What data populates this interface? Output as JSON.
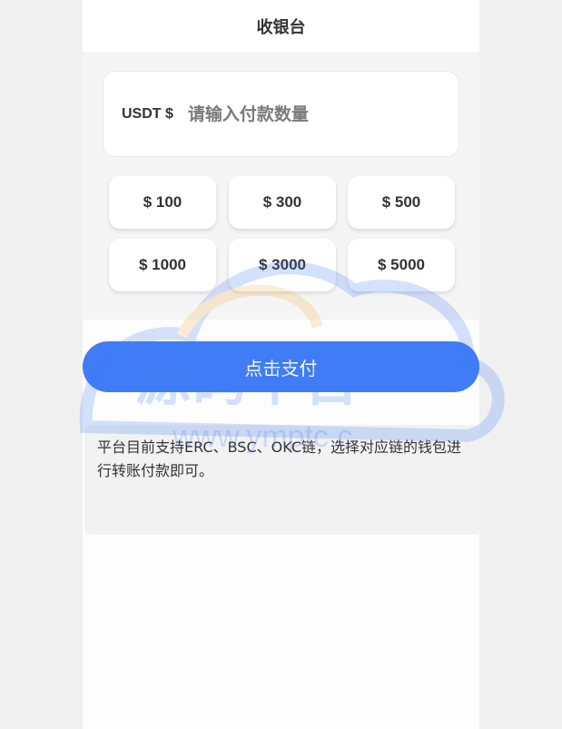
{
  "header": {
    "title": "收银台"
  },
  "amount_form": {
    "currency_label": "USDT $",
    "input_placeholder": "请输入付款数量",
    "input_value": ""
  },
  "presets": [
    {
      "label": "$ 100"
    },
    {
      "label": "$ 300"
    },
    {
      "label": "$ 500"
    },
    {
      "label": "$ 1000"
    },
    {
      "label": "$ 3000"
    },
    {
      "label": "$ 5000"
    }
  ],
  "pay_button": {
    "label": "点击支付"
  },
  "notice": {
    "text": "平台目前支持ERC、BSC、OKC链，选择对应链的钱包进行转账付款即可。"
  },
  "watermark": {
    "title": "源码平台",
    "url": "www.ymptc.c"
  },
  "colors": {
    "accent": "#3f7cf5",
    "background": "#f0f0f0",
    "card": "#ffffff"
  }
}
